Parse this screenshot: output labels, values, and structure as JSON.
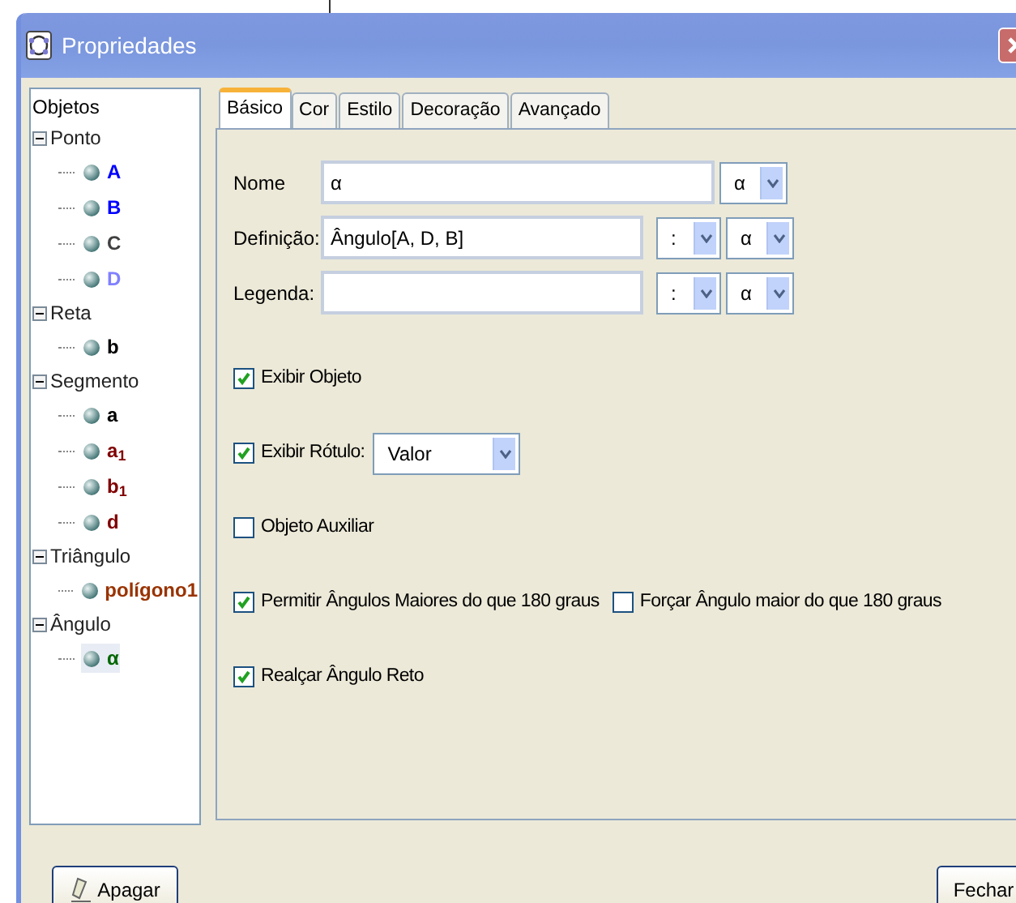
{
  "window": {
    "title": "Propriedades"
  },
  "tree": {
    "label": "Objetos",
    "categories": [
      {
        "label": "Ponto",
        "expanded": true,
        "children": [
          {
            "label": "A",
            "color": "#0000ff",
            "selected": false
          },
          {
            "label": "B",
            "color": "#0000ff",
            "selected": false
          },
          {
            "label": "C",
            "color": "#404040",
            "selected": false
          },
          {
            "label": "D",
            "color": "#8080ff",
            "selected": false
          }
        ]
      },
      {
        "label": "Reta",
        "expanded": true,
        "children": [
          {
            "label": "b",
            "color": "#000000",
            "selected": false
          }
        ]
      },
      {
        "label": "Segmento",
        "expanded": true,
        "children": [
          {
            "label": "a",
            "color": "#000000",
            "selected": false
          },
          {
            "label": "a$_{1}$",
            "color": "#800000",
            "selected": false
          },
          {
            "label": "b$_{1}$",
            "color": "#800000",
            "selected": false
          },
          {
            "label": "d",
            "color": "#800000",
            "selected": false
          }
        ]
      },
      {
        "label": "Triângulo",
        "expanded": true,
        "children": [
          {
            "label": "polígono1",
            "color": "#993300",
            "selected": false
          }
        ]
      },
      {
        "label": "Ângulo",
        "expanded": true,
        "children": [
          {
            "label": "α",
            "color": "#006600",
            "selected": true
          }
        ]
      }
    ]
  },
  "tabs": [
    {
      "label": "Básico",
      "selected": true
    },
    {
      "label": "Cor",
      "selected": false
    },
    {
      "label": "Estilo",
      "selected": false
    },
    {
      "label": "Decoração",
      "selected": false
    },
    {
      "label": "Avançado",
      "selected": false
    }
  ],
  "fields": [
    {
      "label": "Nome",
      "value": "α",
      "symbol_selects": [
        "α"
      ]
    },
    {
      "label": "Definição:",
      "value": "Ângulo[A, D, B]",
      "symbol_selects": [
        ":",
        "α"
      ]
    },
    {
      "label": "Legenda:",
      "symbol_selects": [
        ":",
        "α"
      ]
    }
  ],
  "option_rows": [
    {
      "checkboxes": [
        {
          "label": "Exibir Objeto",
          "checked": true
        }
      ]
    },
    {
      "checkboxes": [
        {
          "label": "Exibir Rótulo:",
          "checked": true,
          "select": "Valor"
        }
      ]
    },
    {
      "checkboxes": [
        {
          "label": "Objeto Auxiliar",
          "checked": false
        }
      ]
    },
    {
      "checkboxes": [
        {
          "label": "Permitir Ângulos Maiores do que 180 graus",
          "checked": true
        },
        {
          "label": "Forçar Ângulo maior do que 180 graus",
          "checked": false
        }
      ]
    },
    {
      "checkboxes": [
        {
          "label": "Realçar Ângulo Reto",
          "checked": true
        }
      ]
    }
  ],
  "buttons": {
    "delete": "Apagar",
    "close": "Fechar"
  }
}
